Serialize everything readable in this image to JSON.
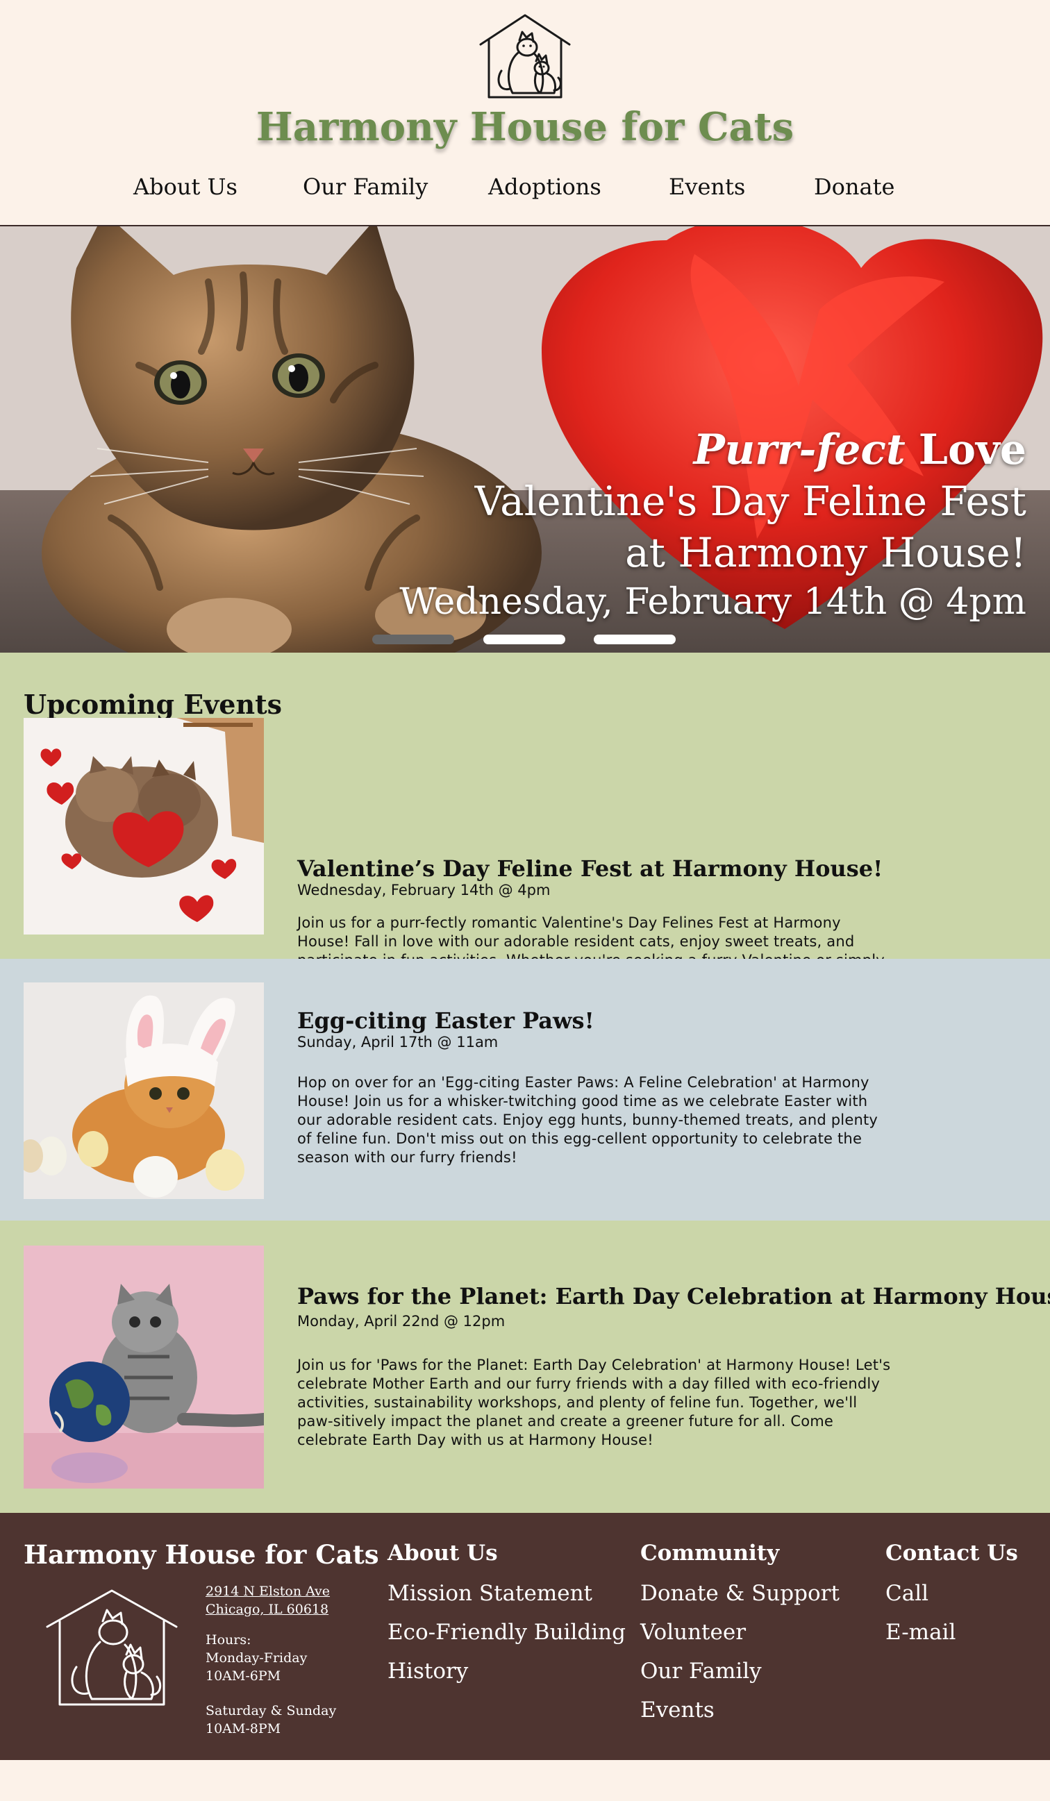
{
  "header": {
    "site_title": "Harmony House for Cats",
    "nav": [
      "About Us",
      "Our Family",
      "Adoptions",
      "Events",
      "Donate"
    ]
  },
  "hero": {
    "line1_italic": "Purr-fect",
    "line1_bold": "Love",
    "line2": "Valentine's Day Feline Fest",
    "line3": "at Harmony House!",
    "line4": "Wednesday, February 14th @ 4pm",
    "carousel_active_index": 0,
    "carousel_count": 3
  },
  "events": {
    "heading": "Upcoming Events",
    "items": [
      {
        "title": "Valentine’s Day Feline Fest at Harmony House!",
        "date": "Wednesday, February 14th @ 4pm",
        "description": "Join us for a purr-fectly romantic Valentine's Day Felines Fest at Harmony House! Fall in love with our adorable resident cats, enjoy sweet treats, and participate in fun activities. Whether you're seeking a furry Valentine or simply want to share the love with our feline friends, this event promises to warm your heart. Spread the love and celebrate with us at Harmony House!"
      },
      {
        "title": "Egg-citing Easter Paws!",
        "date": "Sunday, April 17th @ 11am",
        "description": "Hop on over for an 'Egg-citing Easter Paws: A Feline Celebration' at Harmony House! Join us for a whisker-twitching good time as we celebrate Easter with our adorable resident cats. Enjoy egg hunts, bunny-themed treats, and plenty of feline fun. Don't miss out on this egg-cellent opportunity to celebrate the season with our furry friends!"
      },
      {
        "title": "Paws for the Planet: Earth Day Celebration at Harmony House!",
        "date": "Monday, April 22nd @ 12pm",
        "description": "Join us for 'Paws for the Planet: Earth Day Celebration' at Harmony House! Let's celebrate Mother Earth and our furry friends with a day filled with eco-friendly activities, sustainability workshops, and plenty of feline fun. Together, we'll paw-sitively impact the planet and create a greener future for all. Come celebrate Earth Day with us at Harmony House!"
      }
    ]
  },
  "footer": {
    "brand": "Harmony House for Cats",
    "address_line1": "2914 N Elston Ave",
    "address_line2": "Chicago, IL 60618",
    "hours_label": "Hours:",
    "hours_weekday_days": "Monday-Friday",
    "hours_weekday_time": "10AM-6PM",
    "hours_weekend_days": "Saturday & Sunday",
    "hours_weekend_time": "10AM-8PM",
    "about": {
      "heading": "About Us",
      "links": [
        "Mission Statement",
        "Eco-Friendly Building",
        "History"
      ]
    },
    "community": {
      "heading": "Community",
      "links": [
        "Donate & Support",
        "Volunteer",
        "Our Family",
        "Events"
      ]
    },
    "contact": {
      "heading": "Contact Us",
      "links": [
        "Call",
        "E-mail"
      ]
    }
  },
  "colors": {
    "header_bg": "#fcf2e9",
    "title_green": "#6d8d4f",
    "events_green": "#cbd6a9",
    "events_blue": "#ccd7dc",
    "footer_brown": "#4e3430"
  }
}
